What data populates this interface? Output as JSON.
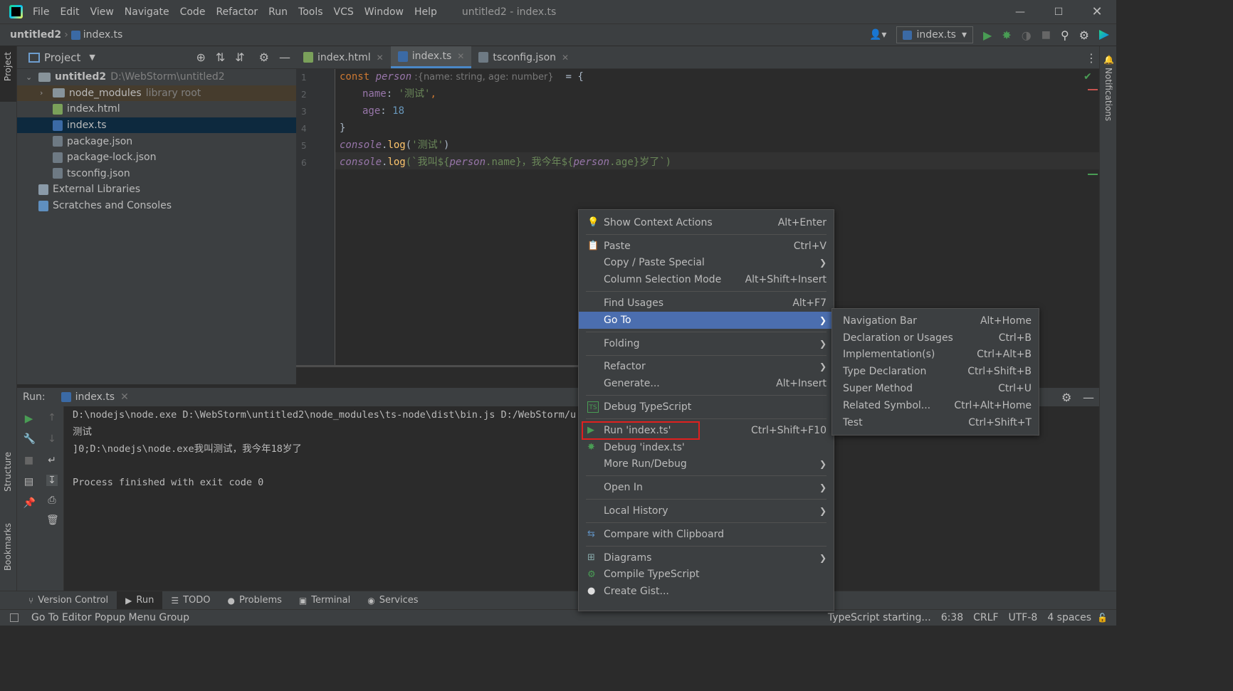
{
  "app": {
    "title": "untitled2 - index.ts"
  },
  "menubar": [
    "File",
    "Edit",
    "View",
    "Navigate",
    "Code",
    "Refactor",
    "Run",
    "Tools",
    "VCS",
    "Window",
    "Help"
  ],
  "breadcrumb": {
    "project": "untitled2",
    "file": "index.ts"
  },
  "run_config": "index.ts",
  "project_panel": {
    "title": "Project"
  },
  "tree": [
    {
      "label": "untitled2",
      "extra": "D:\\WebStorm\\untitled2",
      "level": 0,
      "icon": "folder-icon",
      "expanded": true
    },
    {
      "label": "node_modules",
      "extra": "library root",
      "level": 1,
      "icon": "folder-icon",
      "expanded": false
    },
    {
      "label": "index.html",
      "extra": "",
      "level": 1,
      "icon": "html-file-icon"
    },
    {
      "label": "index.ts",
      "extra": "",
      "level": 1,
      "icon": "ts-file-icon",
      "selected": true
    },
    {
      "label": "package.json",
      "extra": "",
      "level": 1,
      "icon": "json-file-icon"
    },
    {
      "label": "package-lock.json",
      "extra": "",
      "level": 1,
      "icon": "json-file-icon"
    },
    {
      "label": "tsconfig.json",
      "extra": "",
      "level": 1,
      "icon": "json-file-icon"
    },
    {
      "label": "External Libraries",
      "extra": "",
      "level": 0,
      "icon": "library-icon"
    },
    {
      "label": "Scratches and Consoles",
      "extra": "",
      "level": 0,
      "icon": "scratches-icon"
    }
  ],
  "editor_tabs": [
    {
      "label": "index.html",
      "active": false
    },
    {
      "label": "index.ts",
      "active": true
    },
    {
      "label": "tsconfig.json",
      "active": false
    }
  ],
  "code": {
    "line_numbers": [
      "1",
      "2",
      "3",
      "4",
      "5",
      "6"
    ],
    "line1": {
      "kw": "const ",
      "var": "person",
      "hint": " :{name: string, age: number}",
      "rest": "  = {"
    },
    "line2": {
      "key": "name",
      "colon": ": ",
      "str": "'测试'",
      "comma": ","
    },
    "line3": {
      "key": "age",
      "colon": ": ",
      "num": "18"
    },
    "line4": "}",
    "line5": {
      "obj": "console",
      "dot": ".",
      "fn": "log",
      "open": "(",
      "str": "'测试'",
      "close": ")"
    },
    "line6": {
      "obj": "console",
      "dot": ".",
      "fn": "log",
      "open": "(`我叫${",
      "v1": "person",
      "p1": ".name}，我今年${",
      "v2": "person",
      "p2": ".age}岁了`)"
    }
  },
  "run_panel": {
    "label": "Run:",
    "tab": "index.ts",
    "lines": [
      "D:\\nodejs\\node.exe D:\\WebStorm\\untitled2\\node_modules\\ts-node\\dist\\bin.js D:/WebStorm/u",
      "测试",
      "\u001b]0;D:\\nodejs\\node.exe\u0007我叫测试，我今年18岁了",
      "",
      "Process finished with exit code 0"
    ]
  },
  "context_menu": [
    {
      "label": "Show Context Actions",
      "shortcut": "Alt+Enter",
      "icon": "bulb-icon"
    },
    {
      "sep": true
    },
    {
      "label": "Paste",
      "shortcut": "Ctrl+V",
      "icon": "clipboard-icon"
    },
    {
      "label": "Copy / Paste Special",
      "submenu": true
    },
    {
      "label": "Column Selection Mode",
      "shortcut": "Alt+Shift+Insert"
    },
    {
      "sep": true
    },
    {
      "label": "Find Usages",
      "shortcut": "Alt+F7"
    },
    {
      "label": "Go To",
      "submenu": true,
      "highlighted": true
    },
    {
      "sep": true
    },
    {
      "label": "Folding",
      "submenu": true
    },
    {
      "sep": true
    },
    {
      "label": "Refactor",
      "submenu": true
    },
    {
      "label": "Generate...",
      "shortcut": "Alt+Insert"
    },
    {
      "sep": true
    },
    {
      "label": "Debug TypeScript",
      "icon": "ts-debug-icon"
    },
    {
      "sep": true
    },
    {
      "label": "Run 'index.ts'",
      "shortcut": "Ctrl+Shift+F10",
      "icon": "run-icon",
      "boxed": true
    },
    {
      "label": "Debug 'index.ts'",
      "icon": "debug-icon"
    },
    {
      "label": "More Run/Debug",
      "submenu": true
    },
    {
      "sep": true
    },
    {
      "label": "Open In",
      "submenu": true
    },
    {
      "sep": true
    },
    {
      "label": "Local History",
      "submenu": true
    },
    {
      "sep": true
    },
    {
      "label": "Compare with Clipboard",
      "icon": "compare-icon"
    },
    {
      "sep": true
    },
    {
      "label": "Diagrams",
      "submenu": true,
      "icon": "diagram-icon"
    },
    {
      "label": "Compile TypeScript",
      "icon": "compile-icon"
    },
    {
      "label": "Create Gist...",
      "icon": "github-icon"
    }
  ],
  "submenu": [
    {
      "label": "Navigation Bar",
      "shortcut": "Alt+Home"
    },
    {
      "label": "Declaration or Usages",
      "shortcut": "Ctrl+B"
    },
    {
      "label": "Implementation(s)",
      "shortcut": "Ctrl+Alt+B"
    },
    {
      "label": "Type Declaration",
      "shortcut": "Ctrl+Shift+B"
    },
    {
      "label": "Super Method",
      "shortcut": "Ctrl+U"
    },
    {
      "label": "Related Symbol...",
      "shortcut": "Ctrl+Alt+Home"
    },
    {
      "label": "Test",
      "shortcut": "Ctrl+Shift+T"
    }
  ],
  "side_labels": {
    "project": "Project",
    "structure": "Structure",
    "bookmarks": "Bookmarks",
    "notifications": "Notifications"
  },
  "bottom_tabs": [
    "Version Control",
    "Run",
    "TODO",
    "Problems",
    "Terminal",
    "Services"
  ],
  "status": {
    "left": "Go To Editor Popup Menu Group",
    "right": [
      "TypeScript starting...",
      "6:38",
      "CRLF",
      "UTF-8",
      "4 spaces"
    ]
  },
  "colors": {
    "accent": "#4b6eaf",
    "selection": "#0d293e",
    "run_green": "#499c54",
    "box_red": "#e0201f"
  }
}
